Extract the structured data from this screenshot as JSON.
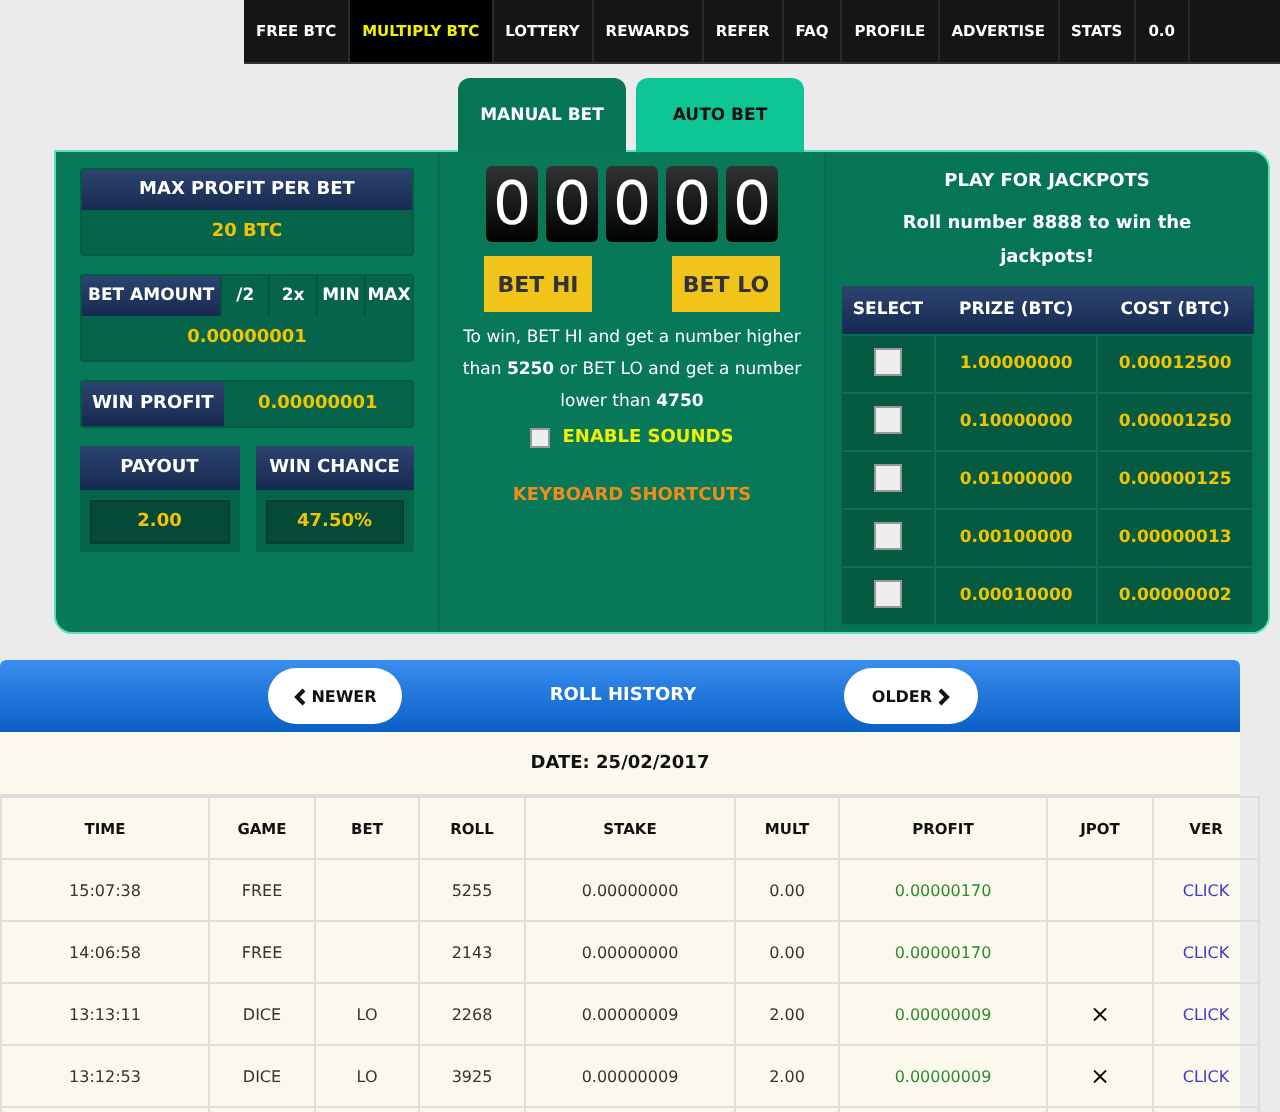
{
  "nav": [
    {
      "label": "FREE BTC",
      "selected": false
    },
    {
      "label": "MULTIPLY BTC",
      "selected": true
    },
    {
      "label": "LOTTERY",
      "selected": false
    },
    {
      "label": "REWARDS",
      "selected": false
    },
    {
      "label": "REFER",
      "selected": false
    },
    {
      "label": "FAQ",
      "selected": false
    },
    {
      "label": "PROFILE",
      "selected": false
    },
    {
      "label": "ADVERTISE",
      "selected": false
    },
    {
      "label": "STATS",
      "selected": false
    },
    {
      "label": "0.0",
      "selected": false
    }
  ],
  "tabs": [
    {
      "label": "MANUAL BET",
      "selected": true
    },
    {
      "label": "AUTO BET",
      "selected": false
    }
  ],
  "max_profit": {
    "label": "MAX PROFIT PER BET",
    "value": "20 BTC"
  },
  "bet_amount": {
    "label": "BET AMOUNT",
    "buttons": [
      "/2",
      "2x",
      "MIN",
      "MAX"
    ],
    "value": "0.00000001"
  },
  "win_profit": {
    "label": "WIN PROFIT",
    "value": "0.00000001"
  },
  "payout": {
    "label": "PAYOUT",
    "value": "2.00"
  },
  "win_chance": {
    "label": "WIN CHANCE",
    "value": "47.50%"
  },
  "digits": [
    "0",
    "0",
    "0",
    "0",
    "0"
  ],
  "bet_buttons": [
    "BET HI",
    "BET LO"
  ],
  "rule_text": "To win, BET HI and get a number higher than **5250** or BET LO and get a number lower than **4750**",
  "sounds": {
    "label": "ENABLE SOUNDS",
    "checked": false
  },
  "shortcuts_link": "KEYBOARD SHORTCUTS",
  "jackpots": {
    "title": "PLAY FOR JACKPOTS",
    "text": "Roll number **8888** to win the jackpots!",
    "columns": [
      "SELECT",
      "PRIZE (BTC)",
      "COST (BTC)"
    ],
    "rows": [
      {
        "checked": false,
        "prize": "1.00000000",
        "cost": "0.00012500"
      },
      {
        "checked": false,
        "prize": "0.10000000",
        "cost": "0.00001250"
      },
      {
        "checked": false,
        "prize": "0.01000000",
        "cost": "0.00000125"
      },
      {
        "checked": false,
        "prize": "0.00100000",
        "cost": "0.00000013"
      },
      {
        "checked": false,
        "prize": "0.00010000",
        "cost": "0.00000002"
      }
    ]
  },
  "history": {
    "newer": "NEWER",
    "title": "ROLL HISTORY",
    "older": "OLDER",
    "date": "DATE: 25/02/2017",
    "columns": [
      "TIME",
      "GAME",
      "BET",
      "ROLL",
      "STAKE",
      "MULT",
      "PROFIT",
      "JPOT",
      "VER"
    ],
    "rows": [
      {
        "time": "15:07:38",
        "game": "FREE",
        "bet": "",
        "roll": "5255",
        "stake": "0.00000000",
        "mult": "0.00",
        "profit": "0.00000170",
        "jpot": "",
        "ver": "CLICK"
      },
      {
        "time": "14:06:58",
        "game": "FREE",
        "bet": "",
        "roll": "2143",
        "stake": "0.00000000",
        "mult": "0.00",
        "profit": "0.00000170",
        "jpot": "",
        "ver": "CLICK"
      },
      {
        "time": "13:13:11",
        "game": "DICE",
        "bet": "LO",
        "roll": "2268",
        "stake": "0.00000009",
        "mult": "2.00",
        "profit": "0.00000009",
        "jpot": "×",
        "ver": "CLICK"
      },
      {
        "time": "13:12:53",
        "game": "DICE",
        "bet": "LO",
        "roll": "3925",
        "stake": "0.00000009",
        "mult": "2.00",
        "profit": "0.00000009",
        "jpot": "×",
        "ver": "CLICK"
      }
    ]
  }
}
